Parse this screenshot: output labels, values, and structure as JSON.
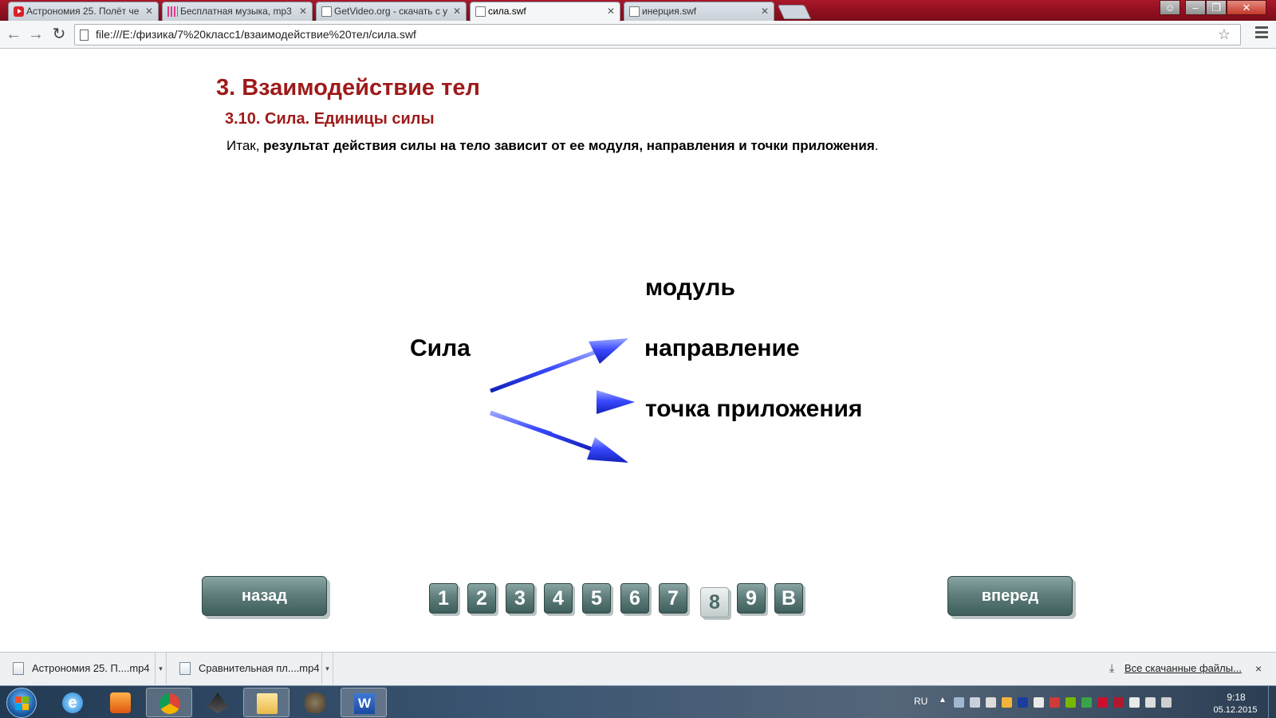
{
  "browser": {
    "tabs": [
      {
        "label": "Астрономия 25. Полёт че",
        "favicon": "youtube-icon"
      },
      {
        "label": "Бесплатная музыка, mp3",
        "favicon": "music-icon"
      },
      {
        "label": "GetVideo.org - скачать с у",
        "favicon": "page-icon"
      },
      {
        "label": "сила.swf",
        "favicon": "page-icon"
      },
      {
        "label": "инерция.swf",
        "favicon": "page-icon"
      }
    ],
    "active_tab": 3,
    "url": "file:///E:/физика/7%20класс1/взаимодействие%20тел/сила.swf"
  },
  "page": {
    "chapter_title": "3. Взаимодействие тел",
    "section_title": "3.10. Сила. Единицы силы",
    "lead_prefix": "Итак, ",
    "lead_bold": "результат действия силы на тело зависит от ее модуля, направления и точки приложения",
    "lead_suffix": ".",
    "diagram": {
      "source": "Сила",
      "targets": [
        "модуль",
        "направление",
        "точка приложения"
      ]
    },
    "nav": {
      "back_label": "назад",
      "forward_label": "вперед",
      "pages": [
        "1",
        "2",
        "3",
        "4",
        "5",
        "6",
        "7",
        "8",
        "9",
        "В"
      ],
      "current_page": "8"
    }
  },
  "downloads": {
    "items": [
      "Астрономия 25. П....mp4",
      "Сравнительная пл....mp4"
    ],
    "all_label": "Все скачанные файлы...",
    "close": "×"
  },
  "taskbar": {
    "language": "RU",
    "time": "9:18",
    "date": "05.12.2015"
  },
  "colors": {
    "heading": "#9e1a1a",
    "arrow": "#2336e0",
    "nav_button": "#5f7e7c"
  }
}
